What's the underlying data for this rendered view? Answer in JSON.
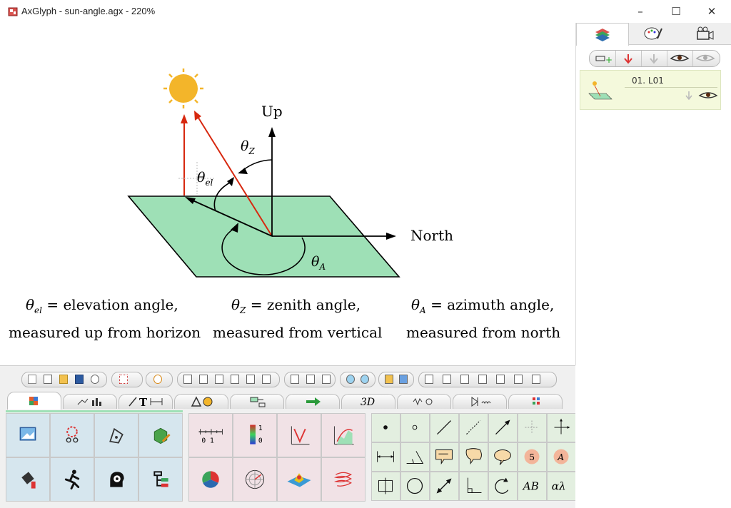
{
  "window": {
    "title": "AxGlyph - sun-angle.agx - 220%",
    "minimize": "–",
    "maximize": "☐",
    "close": "✕"
  },
  "diagram": {
    "up_label": "Up",
    "north_label": "North",
    "theta_el": "θel",
    "theta_z": "θZ",
    "theta_a": "θA",
    "captions": [
      {
        "symbol": "θ",
        "sub": "el",
        "line1": " = elevation angle,",
        "line2": "measured up from horizon"
      },
      {
        "symbol": "θ",
        "sub": "Z",
        "line1": " = zenith angle,",
        "line2": "measured from vertical"
      },
      {
        "symbol": "θ",
        "sub": "A",
        "line1": " = azimuth angle,",
        "line2": "measured from north"
      }
    ],
    "colors": {
      "plane": "#9ee0b6",
      "ray": "#d7280f",
      "sun": "#f3b52a",
      "ink": "#000000"
    }
  },
  "layers": {
    "item_label": "01. L01"
  },
  "palette": {
    "p2_ruler_text": "0 1",
    "p2_colorbar_top": "1",
    "p2_colorbar_bottom": "0",
    "p3_label_5": "5",
    "p3_label_A": "A",
    "p3_label_AB": "AB",
    "p3_label_alpha": "αλ"
  },
  "tabs": {
    "text_tab": "T",
    "threed_tab": "3D"
  }
}
